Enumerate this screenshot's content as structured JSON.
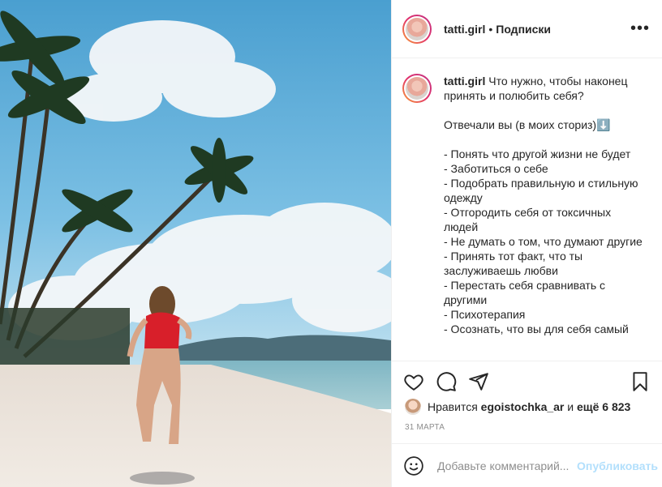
{
  "post": {
    "username": "tatti.girl",
    "separator": "•",
    "follow_label": "Подписки",
    "more_icon": "more-horizontal-icon"
  },
  "caption": {
    "username": "tatti.girl",
    "text": "Что нужно, чтобы наконец принять и полюбить себя?\n\nОтвечали вы (в моих сториз)⬇️\n\n- Понять что другой жизни не будет\n- Заботиться о себе\n- Подобрать правильную и стильную одежду\n- Отгородить себя от токсичных людей\n- Не думать о том, что думают другие\n- Принять тот факт, что ты заслуживаешь любви\n- Перестать себя сравнивать с другими\n- Психотерапия\n- Осознать, что вы для себя самый"
  },
  "actions": {
    "like_icon": "heart-icon",
    "comment_icon": "comment-icon",
    "share_icon": "share-icon",
    "save_icon": "bookmark-icon"
  },
  "likes": {
    "prefix": "Нравится",
    "user": "egoistochka_ar",
    "middle": "и",
    "others": "ещё 6 823"
  },
  "date": "31 МАРТА",
  "comment_box": {
    "emoji_icon": "smile-icon",
    "placeholder": "Добавьте комментарий...",
    "publish_label": "Опубликовать",
    "publish_color": "#b2dffc"
  }
}
